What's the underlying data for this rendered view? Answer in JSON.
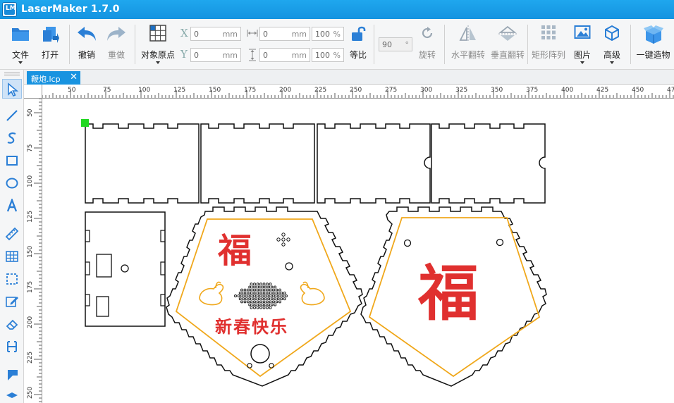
{
  "window": {
    "title": "LaserMaker 1.7.0",
    "icon_text": "LM"
  },
  "toolbar": {
    "file": "文件",
    "open": "打开",
    "undo": "撤销",
    "redo": "重做",
    "origin": "对象原点",
    "x_label": "X",
    "y_label": "Y",
    "x_value": "0",
    "y_value": "0",
    "unit_mm": "mm",
    "width_value": "0",
    "height_value": "0",
    "width_pct": "100",
    "height_pct": "100",
    "pct_unit": "%",
    "proportional": "等比",
    "rotate_value": "90",
    "rotate_unit": "°",
    "rotate": "旋转",
    "flip_h": "水平翻转",
    "flip_v": "垂直翻转",
    "array": "矩形阵列",
    "image": "图片",
    "advanced": "高级",
    "one_click": "一键造物"
  },
  "tabs": [
    {
      "label": "鞭炮.lcp",
      "close": "✕"
    }
  ],
  "ruler": {
    "h_labels": [
      "50",
      "75",
      "100",
      "125",
      "150",
      "175",
      "200",
      "225",
      "250",
      "275",
      "300",
      "325",
      "350",
      "375",
      "400",
      "425",
      "450",
      "47"
    ],
    "v_labels": [
      "50",
      "75",
      "100",
      "125",
      "150",
      "175",
      "200",
      "225",
      "250"
    ]
  },
  "design": {
    "fu_char": "福",
    "greeting": "新春快乐"
  },
  "colors": {
    "accent": "#1893e0",
    "outline": "#111111",
    "engrave": "#f0a81c",
    "red": "#e0302f",
    "handle": "#22d822"
  }
}
